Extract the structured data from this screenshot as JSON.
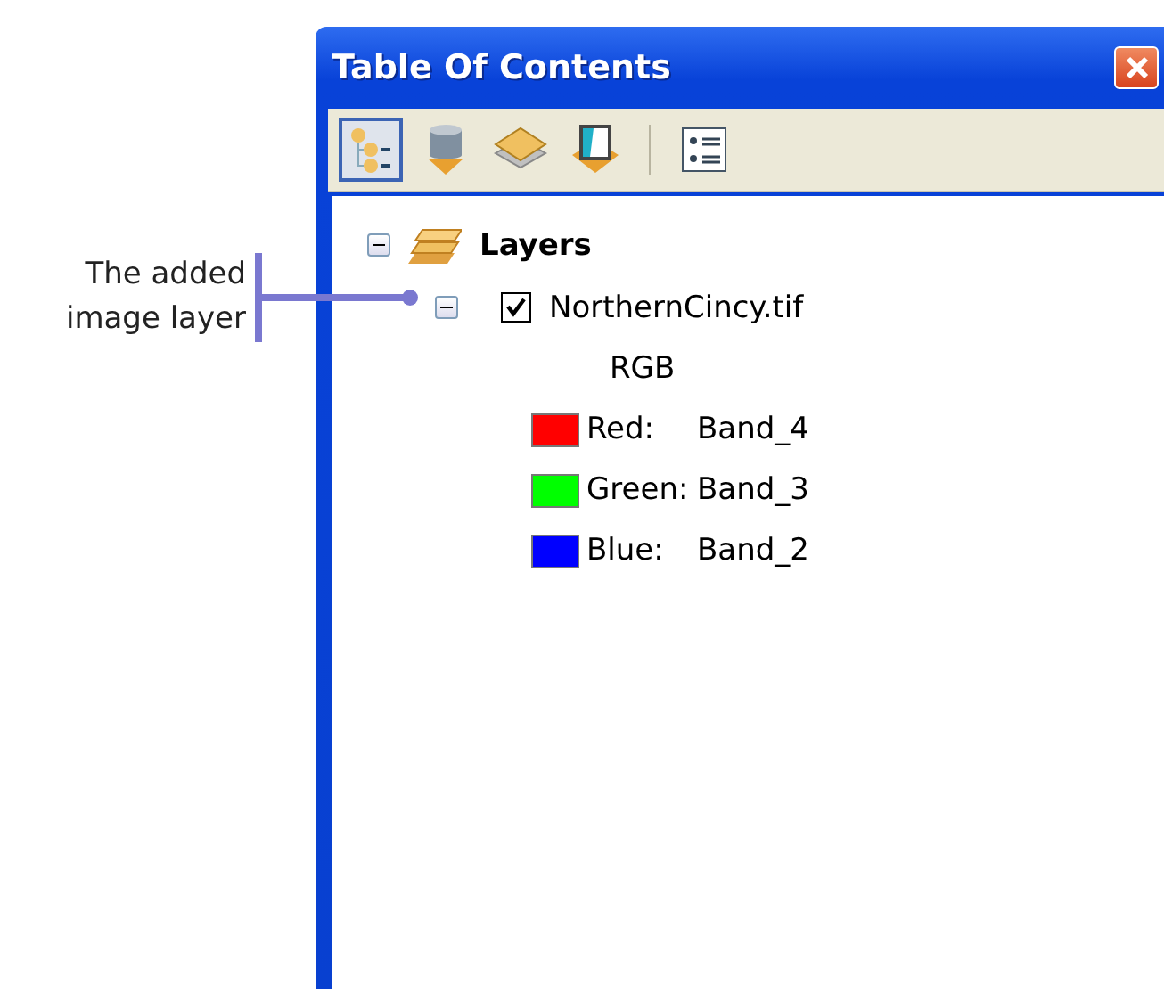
{
  "callout": {
    "text": "The added image layer"
  },
  "window": {
    "title": "Table Of Contents"
  },
  "toolbar": [
    {
      "kind": "drawing-order",
      "selected": true
    },
    {
      "kind": "source",
      "selected": false
    },
    {
      "kind": "visibility",
      "selected": false
    },
    {
      "kind": "selection",
      "selected": false
    },
    {
      "kind": "separator"
    },
    {
      "kind": "options",
      "selected": false
    }
  ],
  "tree": [
    {
      "label": "Layers",
      "kind": "group",
      "expanded": true,
      "children": [
        {
          "label": "NorthernCincy.tif",
          "kind": "raster",
          "expanded": true,
          "checked": true,
          "legend": {
            "heading": "RGB",
            "entries": [
              {
                "label": "Red:",
                "value": "Band_4",
                "color": "#ff0000"
              },
              {
                "label": "Green:",
                "value": "Band_3",
                "color": "#00ff00"
              },
              {
                "label": "Blue:",
                "value": "Band_2",
                "color": "#0000ff"
              }
            ]
          }
        }
      ]
    }
  ]
}
